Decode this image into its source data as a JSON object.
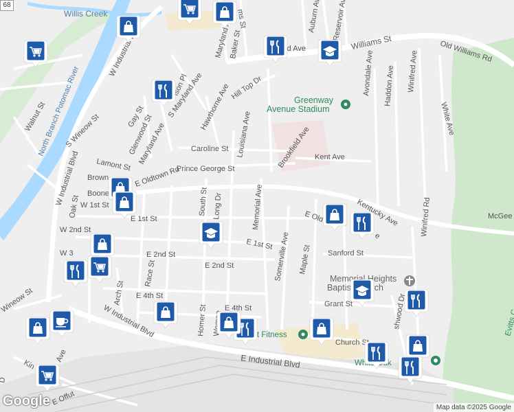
{
  "map": {
    "attribution": "Map data ©2025 Google",
    "logo": "Google",
    "route_badge": "68",
    "water": {
      "river_name": "North Branch Potomac River",
      "creek_name": "Willis Creek"
    },
    "places": {
      "stadium_line1": "Greenway",
      "stadium_line2": "Avenue Stadium",
      "church_line1": "Memorial Heights",
      "church_line2": "Baptist Church",
      "fitness": "t Fitness",
      "white_oak": "White Oak",
      "evitts": "Evitts C"
    },
    "streets": {
      "williams_st": "Williams St",
      "old_williams_rd": "Old Williams Rd",
      "e_industrial_blvd": "E Industrial Blvd",
      "w_industrial_blvd_top": "W Industrial Blvd",
      "w_industrial_blvd_left": "W Industrial Blvd",
      "w_industrial_blvd_bottom": "W Industrial Blvd",
      "e_oldtown_rd": "E Oldtown Rd",
      "e_oldtown_rd_2": "E Old",
      "kentucky_ave": "Kentucky Ave",
      "prince_george_st": "Prince George St",
      "caroline_st": "Caroline St",
      "kent_ave": "Kent Ave",
      "brookfield_ave": "Brookfield Ave",
      "louisiana_ave": "Louisiana Ave",
      "memorial_ave": "Memorial Ave",
      "somerville_ave": "Somerville Ave",
      "maple_st": "Maple St",
      "sanford_st": "Sanford St",
      "grant_st": "Grant St",
      "church_st": "Church St",
      "e_1st_st": "E 1st St",
      "e_1st_st_2": "E 1st St",
      "e_2nd_st": "E 2nd St",
      "e_2nd_st_2": "E 2nd St",
      "e_4th_st": "E 4th St",
      "e_4th_st_2": "E 4th St",
      "w_1st_st": "W 1st St",
      "w_2nd_st": "W 2nd St",
      "w_3rd": "W 3",
      "arch_st": "Arch St",
      "race_st": "Race St",
      "south_st": "South St",
      "long_dr": "Long Dr",
      "homer_st": "Homer St",
      "wempe_st": "Wempe",
      "oak_st": "Oak St",
      "brown": "Brown",
      "boone": "Boone",
      "lamont_st": "Lamont St",
      "s_wineow_st": "S Wineow St",
      "wineow_st": "Wineow St",
      "walnut_st": "Walnut St",
      "gay_st": "Gay St",
      "glenwood_st": "Glenwood St",
      "maryland_ave": "Maryland Ave",
      "s_maryland_ave": "S Maryland Ave",
      "maryland_ave_top": "Maryland Ave",
      "baker_st": "Baker St",
      "hawthorne_ave": "Hawthorne Ave",
      "hill_top_dr": "Hill Top Dr",
      "auburn_ave": "Auburn Ave",
      "reservoir_ave": "Reservoir Ave",
      "avondale_ave": "Avondale Ave",
      "haddon_ave": "Haddon Ave",
      "winifred_ave": "Winifred Ave",
      "winifred_rd": "Winifred Rd",
      "white_ave": "White Ave",
      "mcgee": "McGee",
      "ashwood_dr": "shwood Dr",
      "kin": "Kin",
      "ave": "Ave",
      "offutt": "E Offut",
      "dr": "D",
      "rd_ave": "rd Ave",
      "ison_pl": "ison Pl",
      "ms": "ms St",
      "te": "e"
    },
    "markers": [
      {
        "type": "shopping-bag"
      },
      {
        "type": "shopping-cart"
      },
      {
        "type": "shopping-bag"
      },
      {
        "type": "shopping-bag"
      },
      {
        "type": "shopping-cart"
      },
      {
        "type": "restaurant"
      },
      {
        "type": "school"
      },
      {
        "type": "restaurant"
      },
      {
        "type": "shopping-bag"
      },
      {
        "type": "shopping-bag"
      },
      {
        "type": "school"
      },
      {
        "type": "shopping-bag"
      },
      {
        "type": "restaurant"
      },
      {
        "type": "shopping-bag"
      },
      {
        "type": "shopping-cart"
      },
      {
        "type": "restaurant"
      },
      {
        "type": "school"
      },
      {
        "type": "restaurant"
      },
      {
        "type": "shopping-bag"
      },
      {
        "type": "cafe"
      },
      {
        "type": "shopping-cart"
      },
      {
        "type": "restaurant"
      },
      {
        "type": "shopping-bag"
      },
      {
        "type": "restaurant"
      },
      {
        "type": "shopping-bag"
      },
      {
        "type": "restaurant"
      },
      {
        "type": "shopping-bag"
      }
    ]
  }
}
